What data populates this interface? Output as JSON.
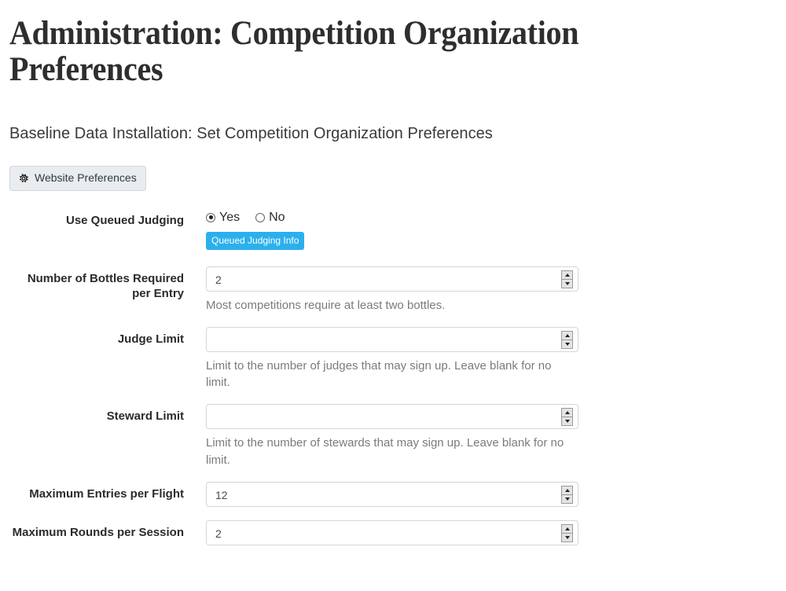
{
  "header": {
    "title": "Administration: Competition Organization Preferences",
    "subtitle": "Baseline Data Installation: Set Competition Organization Preferences"
  },
  "toolbar": {
    "website_preferences_label": "Website Preferences",
    "gear_icon": "gear-icon"
  },
  "colors": {
    "badge_blue": "#2bb0ec",
    "tab_bg": "#e9edf0",
    "tab_border": "#cfd6dc",
    "label_text": "#2b2b2b",
    "help_text": "#7b7b7b",
    "input_border": "#d6d6d6"
  },
  "form": {
    "queued_judging": {
      "label": "Use Queued Judging",
      "options": [
        {
          "label": "Yes",
          "value": "yes",
          "selected": true
        },
        {
          "label": "No",
          "value": "no",
          "selected": false
        }
      ],
      "badge_label": "Queued Judging Info"
    },
    "bottles_required": {
      "label": "Number of Bottles Required per Entry",
      "value": "2",
      "placeholder": "",
      "help": "Most competitions require at least two bottles."
    },
    "judge_limit": {
      "label": "Judge Limit",
      "value": "",
      "placeholder": "",
      "help": "Limit to the number of judges that may sign up. Leave blank for no limit."
    },
    "steward_limit": {
      "label": "Steward Limit",
      "value": "",
      "placeholder": "",
      "help": "Limit to the number of stewards that may sign up. Leave blank for no limit."
    },
    "max_entries_per_flight": {
      "label": "Maximum Entries per Flight",
      "value": "12",
      "placeholder": "",
      "help": ""
    },
    "max_rounds_per_session": {
      "label": "Maximum Rounds per Session",
      "value": "2",
      "placeholder": "",
      "help": ""
    }
  }
}
